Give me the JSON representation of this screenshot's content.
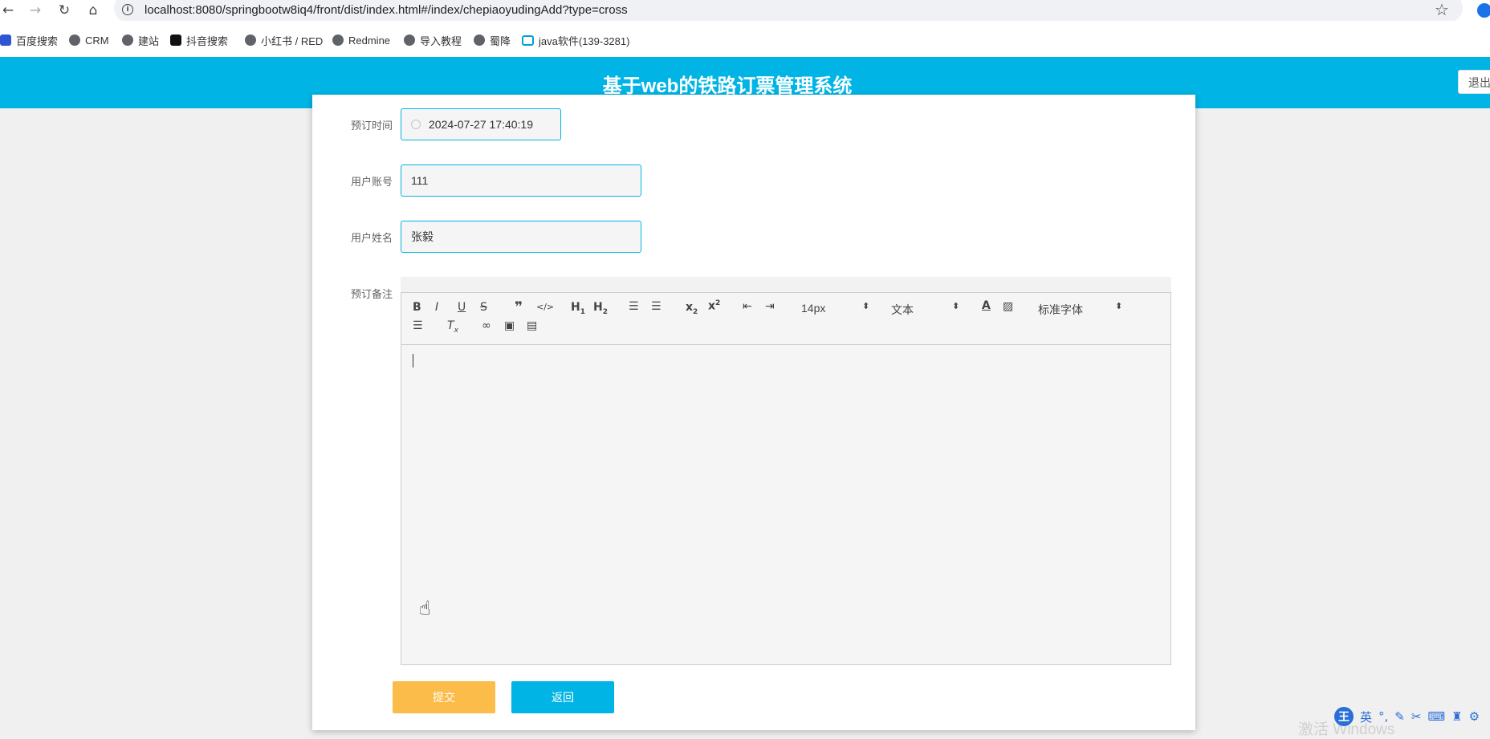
{
  "browser": {
    "url": "localhost:8080/springbootw8iq4/front/dist/index.html#/index/chepiaoyudingAdd?type=cross",
    "bookmarks": [
      "百度搜索",
      "CRM",
      "建站",
      "抖音搜索",
      "小红书 / RED",
      "Redmine",
      "导入教程",
      "蜀降",
      "java软件(139-3281)"
    ]
  },
  "header": {
    "title": "基于web的铁路订票管理系统",
    "logout_label": "退出"
  },
  "form": {
    "reserve_time": {
      "label": "预订时间",
      "value": "2024-07-27 17:40:19"
    },
    "user_account": {
      "label": "用户账号",
      "value": "111"
    },
    "user_name": {
      "label": "用户姓名",
      "value": "张毅"
    },
    "remark": {
      "label": "预订备注",
      "value": ""
    }
  },
  "editor": {
    "font_size": "14px",
    "header_select": "文本",
    "font_family": "标准字体",
    "tool_icons": [
      "bold-icon",
      "italic-icon",
      "underline-icon",
      "strikethrough-icon",
      "blockquote-icon",
      "code-block-icon",
      "h1-icon",
      "h2-icon",
      "ordered-list-icon",
      "bullet-list-icon",
      "subscript-icon",
      "superscript-icon",
      "outdent-icon",
      "indent-icon",
      "font-color-icon",
      "background-color-icon",
      "align-left-icon",
      "clean-format-icon",
      "link-icon",
      "image-icon",
      "video-icon"
    ]
  },
  "actions": {
    "submit_label": "提交",
    "back_label": "返回"
  },
  "system": {
    "watermark": "激活 Windows",
    "ime_logo": "王",
    "ime_mode": "英"
  },
  "colors": {
    "header": "#00b5e5",
    "submit": "#fbbc49",
    "back": "#00b5e5"
  }
}
